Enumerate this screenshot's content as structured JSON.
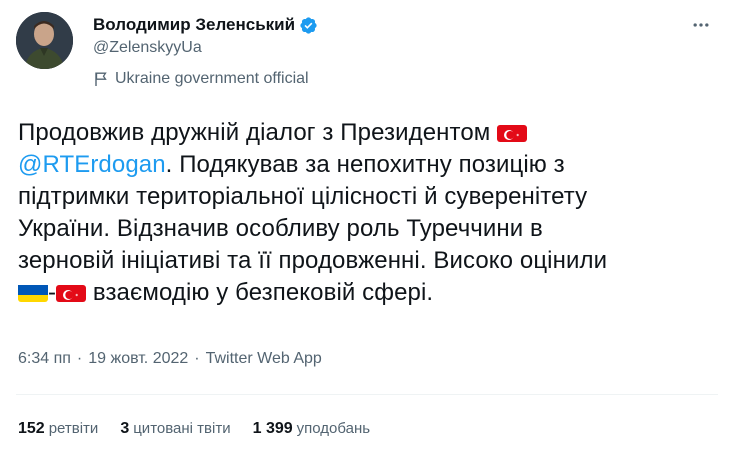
{
  "author": {
    "display_name": "Володимир Зеленський",
    "handle": "@ZelenskyyUa",
    "affiliation": "Ukraine government official"
  },
  "tweet": {
    "line1": "Продовжив дружній діалог з Президентом",
    "mention": "@RTErdogan",
    "line2_rest": ". Подякував за непохитну позицію з",
    "line3": "підтримки територіальної цілісності й суверенітету",
    "line4": "України. Відзначив особливу роль Туреччини в",
    "line5": "зерновій ініціативі та її продовженні. Високо оцінили",
    "dash": "-",
    "line6_rest": " взаємодію у безпековій сфері."
  },
  "meta": {
    "time": "6:34 пп",
    "sep": "·",
    "date": "19 жовт. 2022",
    "source": "Twitter Web App"
  },
  "stats": {
    "retweets_count": "152",
    "retweets_label": "ретвіти",
    "quotes_count": "3",
    "quotes_label": "цитовані твіти",
    "likes_count": "1 399",
    "likes_label": "уподобань"
  },
  "colors": {
    "accent": "#1d9bf0",
    "text": "#0f1419",
    "secondary": "#536471",
    "turkey_red": "#e30a17",
    "ukraine_blue": "#0057b7",
    "ukraine_yellow": "#ffd700"
  },
  "icons": {
    "verified": "verified-badge-icon",
    "more": "more-dots-icon",
    "affiliation": "flag-outline-icon"
  }
}
